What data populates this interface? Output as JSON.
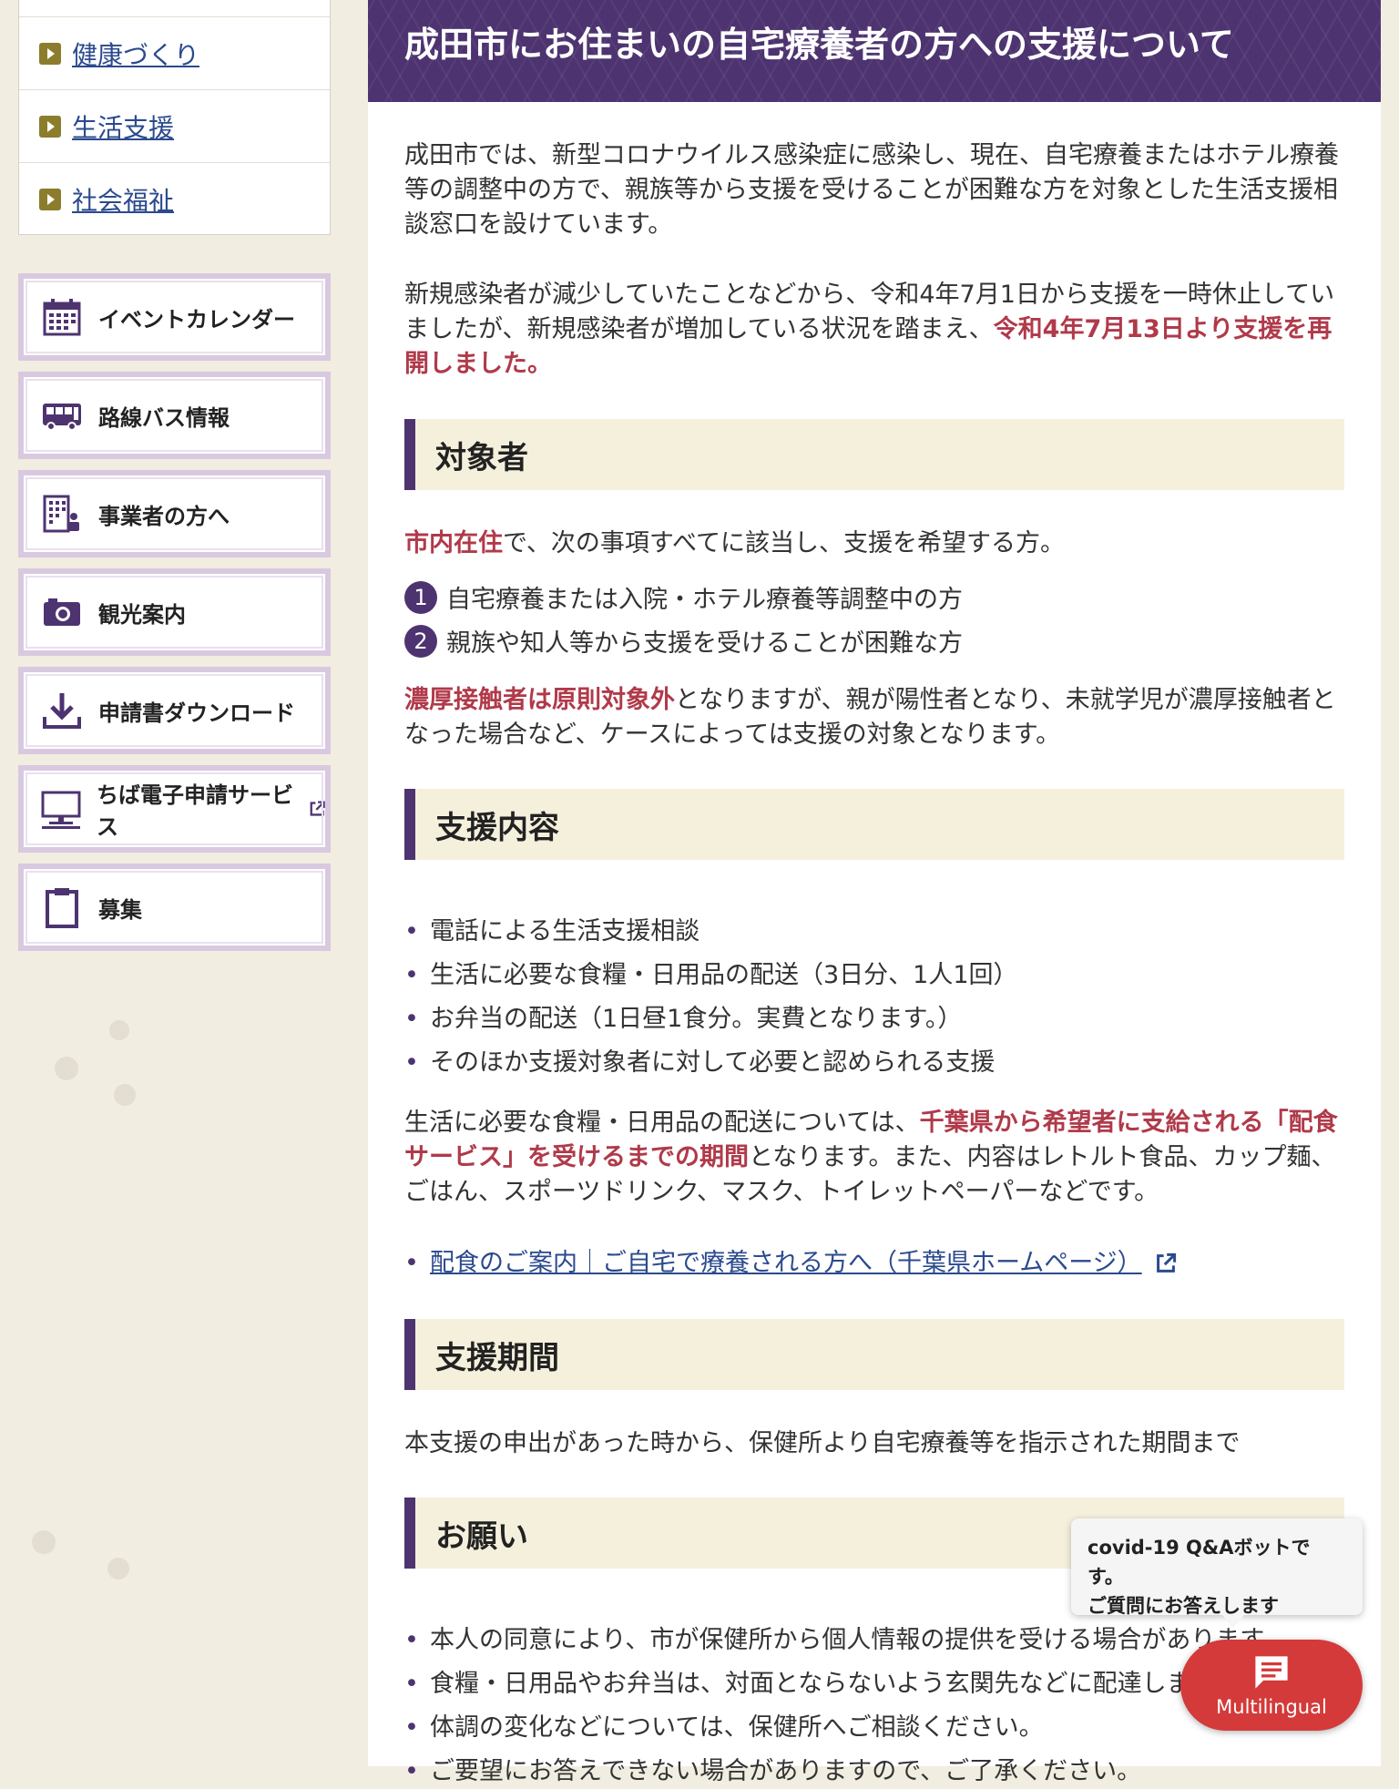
{
  "subnav": {
    "items": [
      {
        "label": "健康づくり"
      },
      {
        "label": "生活支援"
      },
      {
        "label": "社会福祉"
      }
    ]
  },
  "menu": {
    "items": [
      {
        "label": "イベントカレンダー",
        "icon": "calendar-icon"
      },
      {
        "label": "路線バス情報",
        "icon": "bus-icon"
      },
      {
        "label": "事業者の方へ",
        "icon": "building-icon"
      },
      {
        "label": "観光案内",
        "icon": "camera-icon"
      },
      {
        "label": "申請書ダウンロード",
        "icon": "download-icon"
      },
      {
        "label": "ちば電子申請サービス",
        "icon": "monitor-icon"
      },
      {
        "label": "募集",
        "icon": "clipboard-icon"
      }
    ]
  },
  "page": {
    "title": "成田市にお住まいの自宅療養者の方への支援について",
    "intro": "成田市では、新型コロナウイルス感染症に感染し、現在、自宅療養またはホテル療養等の調整中の方で、親族等から支援を受けることが困難な方を対象とした生活支援相談窓口を設けています。",
    "resume_pre": "新規感染者が減少していたことなどから、令和4年7月1日から支援を一時休止していましたが、新規感染者が増加している状況を踏まえ、",
    "resume_red": "令和4年7月13日より支援を再開しました。"
  },
  "sections": {
    "target": {
      "heading": "対象者",
      "lead_red": "市内在住",
      "lead_rest": "で、次の事項すべてに該当し、支援を希望する方。",
      "items": [
        {
          "num": "1",
          "text": "自宅療養または入院・ホテル療養等調整中の方"
        },
        {
          "num": "2",
          "text": "親族や知人等から支援を受けることが困難な方"
        }
      ],
      "note_red": "濃厚接触者は原則対象外",
      "note_rest": "となりますが、親が陽性者となり、未就学児が濃厚接触者となった場合など、ケースによっては支援の対象となります。"
    },
    "content": {
      "heading": "支援内容",
      "bullets": [
        "電話による生活支援相談",
        "生活に必要な食糧・日用品の配送（3日分、1人1回）",
        "お弁当の配送（1日昼1食分。実費となります。）",
        "そのほか支援対象者に対して必要と認められる支援"
      ],
      "food_pre": "生活に必要な食糧・日用品の配送については、",
      "food_red": "千葉県から希望者に支給される「配食サービス」を受けるまでの期間",
      "food_rest": "となります。また、内容はレトルト食品、カップ麺、ごはん、スポーツドリンク、マスク、トイレットペーパーなどです。",
      "link": "配食のご案内｜ご自宅で療養される方へ（千葉県ホームページ）"
    },
    "period": {
      "heading": "支援期間",
      "text": "本支援の申出があった時から、保健所より自宅療養等を指示された期間まで"
    },
    "request": {
      "heading": "お願い",
      "bullets": [
        "本人の同意により、市が保健所から個人情報の提供を受ける場合があります。",
        "食糧・日用品やお弁当は、対面とならないよう玄関先などに配達します。",
        "体調の変化などについては、保健所へご相談ください。",
        "ご要望にお答えできない場合がありますので、ご了承ください。"
      ]
    }
  },
  "chat": {
    "line1": "covid-19 Q&Aボットです。",
    "line2": "ご質問にお答えします",
    "button": "Multilingual"
  },
  "colors": {
    "accent": "#4d3470",
    "red": "#b03a4a",
    "heading_bg": "#f4f0dc",
    "chat": "#d43a3a"
  }
}
